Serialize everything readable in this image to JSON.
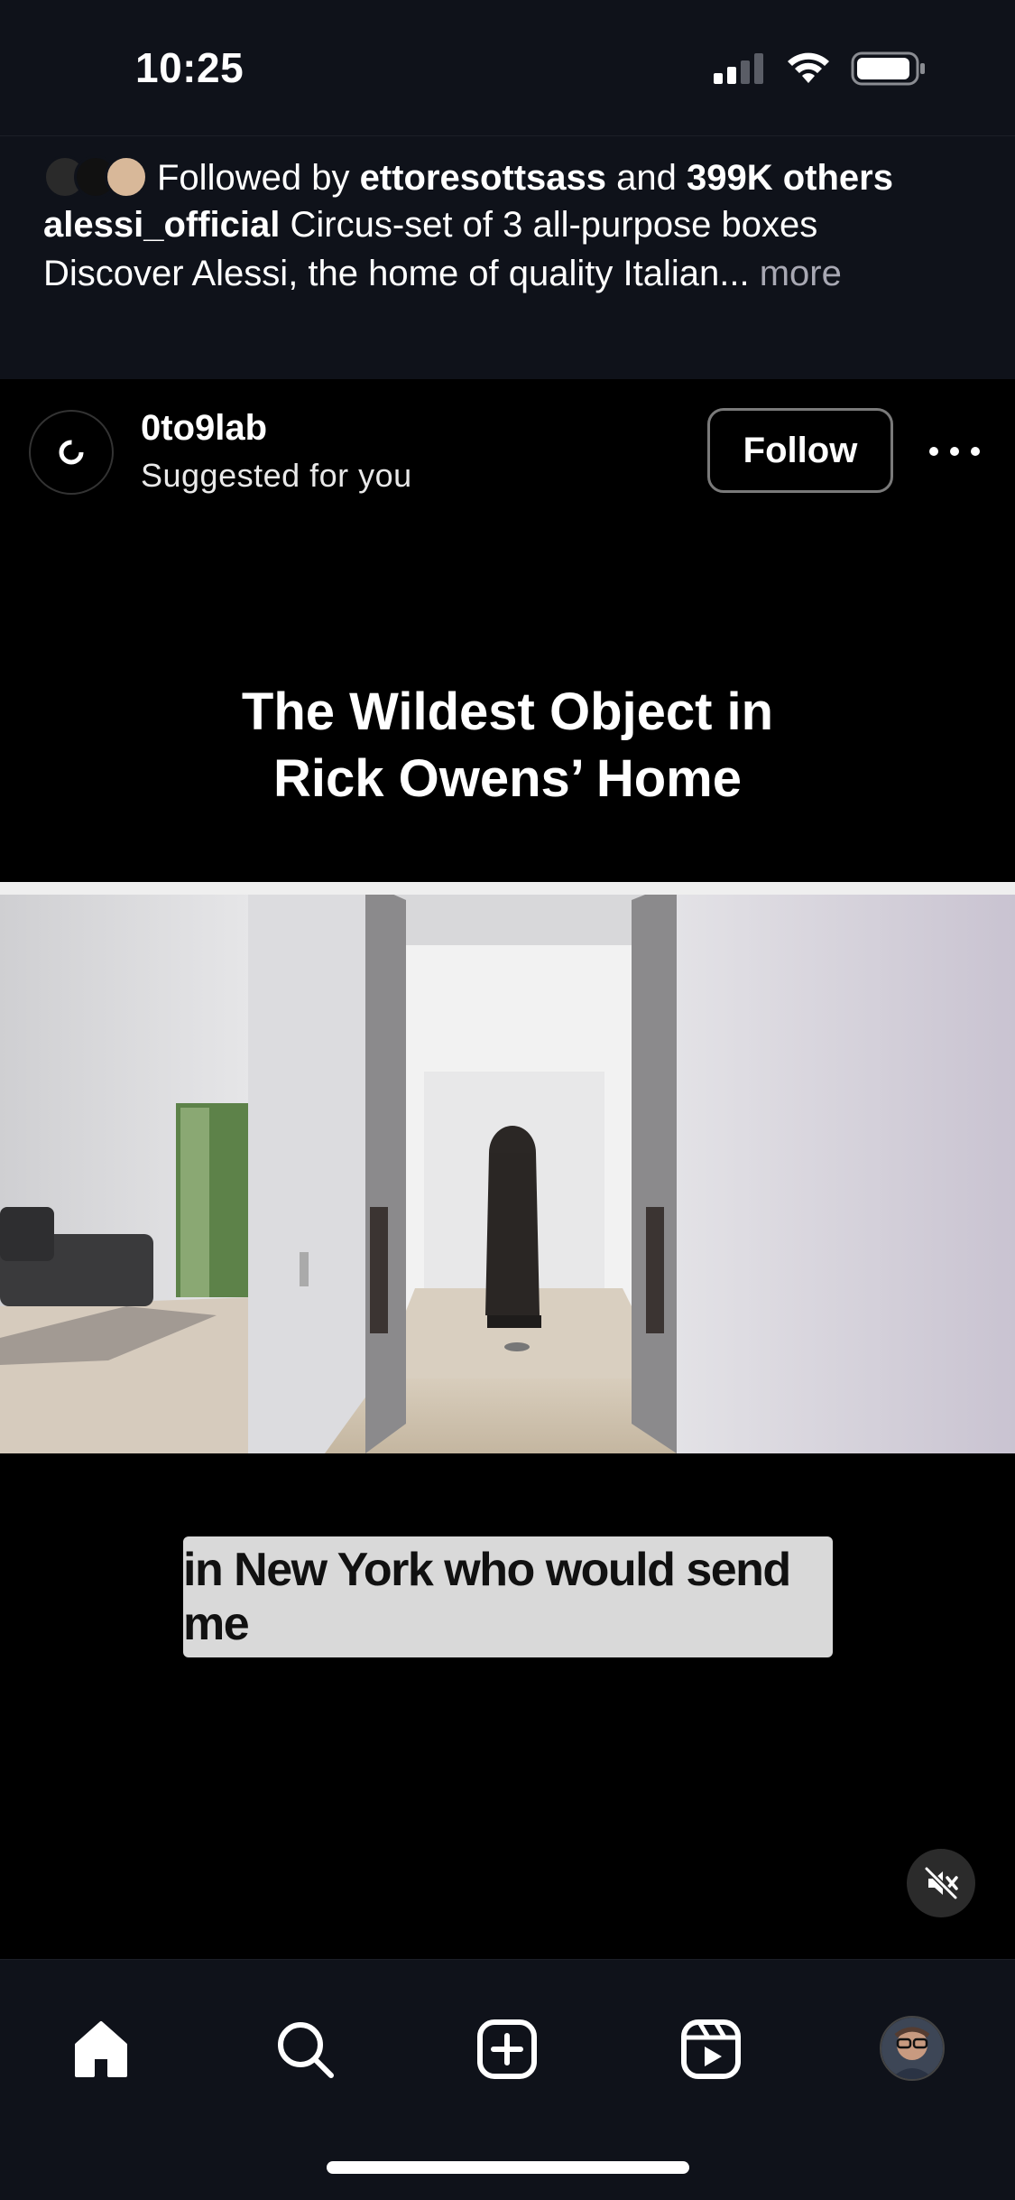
{
  "status_bar": {
    "time": "10:25",
    "icons": [
      "cellular-signal-icon",
      "wifi-icon",
      "battery-icon"
    ]
  },
  "previous_post": {
    "followed_by": {
      "prefix": "Followed by",
      "user": "ettoresottsass",
      "connector": "and",
      "others": "399K others"
    },
    "caption": {
      "username": "alessi_official",
      "text_line1": "Circus-set of 3 all-purpose boxes",
      "text_line2": "Discover Alessi, the home of quality Italian...",
      "more_label": "more"
    }
  },
  "post": {
    "username": "0to9lab",
    "subtitle": "Suggested for you",
    "follow_label": "Follow",
    "media": {
      "title_line1": "The Wildest Object in",
      "title_line2": "Rick Owens’ Home",
      "caption_overlay": "in New York who would send me",
      "muted": true
    }
  },
  "tab_bar": {
    "tabs": [
      "home-icon",
      "search-icon",
      "create-post-icon",
      "reels-icon",
      "profile-avatar"
    ]
  },
  "colors": {
    "chrome_bg": "#0f121a",
    "media_bg": "#000000",
    "muted_text": "#a8a8b3",
    "overlay_box": "#d9d9d9"
  }
}
